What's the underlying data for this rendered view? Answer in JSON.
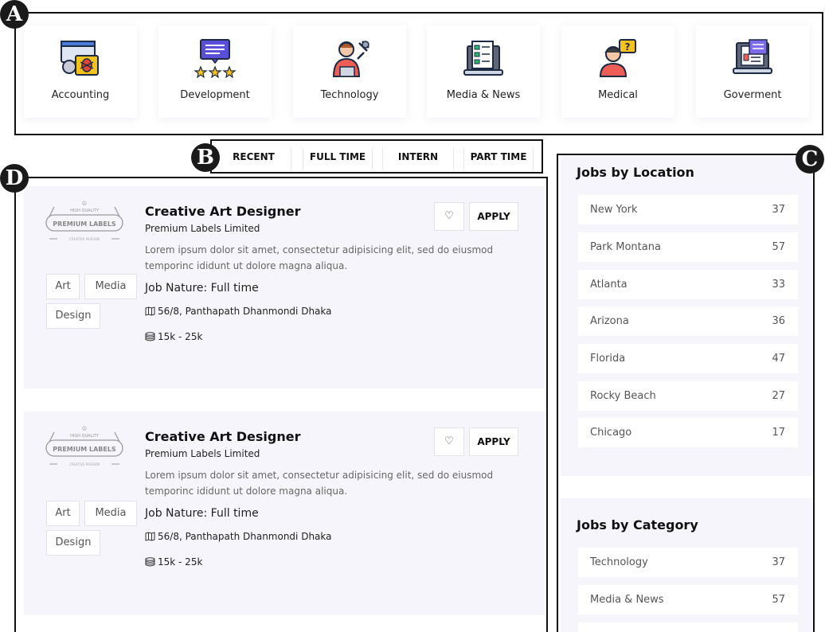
{
  "markers": [
    "A",
    "B",
    "C",
    "D"
  ],
  "categories": [
    {
      "label": "Accounting",
      "icon": "accounting-icon"
    },
    {
      "label": "Development",
      "icon": "development-icon"
    },
    {
      "label": "Technology",
      "icon": "technology-icon"
    },
    {
      "label": "Media & News",
      "icon": "media-news-icon"
    },
    {
      "label": "Medical",
      "icon": "medical-icon"
    },
    {
      "label": "Goverment",
      "icon": "government-icon"
    }
  ],
  "tabs": [
    "RECENT",
    "FULL TIME",
    "INTERN",
    "PART TIME"
  ],
  "jobs": [
    {
      "title": "Creative Art Designer",
      "company": "Premium Labels Limited",
      "description": "Lorem ipsum dolor sit amet, consectetur adipisicing elit, sed do eiusmod temporinc ididunt ut dolore magna aliqua.",
      "nature": "Job Nature: Full time",
      "address": "56/8, Panthapath Dhanmondi Dhaka",
      "salary": "15k - 25k",
      "tags": [
        "Art",
        "Media",
        "Design"
      ],
      "apply_label": "APPLY",
      "logo": {
        "top": "HIGH QUALITY",
        "main": "PREMIUM LABELS",
        "bottom": "CREATIVE PASSION"
      }
    },
    {
      "title": "Creative Art Designer",
      "company": "Premium Labels Limited",
      "description": "Lorem ipsum dolor sit amet, consectetur adipisicing elit, sed do eiusmod temporinc ididunt ut dolore magna aliqua.",
      "nature": "Job Nature: Full time",
      "address": "56/8, Panthapath Dhanmondi Dhaka",
      "salary": "15k - 25k",
      "tags": [
        "Art",
        "Media",
        "Design"
      ],
      "apply_label": "APPLY",
      "logo": {
        "top": "HIGH QUALITY",
        "main": "PREMIUM LABELS",
        "bottom": "CREATIVE PASSION"
      }
    }
  ],
  "sidebar": {
    "location_title": "Jobs by Location",
    "locations": [
      {
        "name": "New York",
        "count": "37"
      },
      {
        "name": "Park Montana",
        "count": "57"
      },
      {
        "name": "Atlanta",
        "count": "33"
      },
      {
        "name": "Arizona",
        "count": "36"
      },
      {
        "name": "Florida",
        "count": "47"
      },
      {
        "name": "Rocky Beach",
        "count": "27"
      },
      {
        "name": "Chicago",
        "count": "17"
      }
    ],
    "category_title": "Jobs by Category",
    "category_items": [
      {
        "name": "Technology",
        "count": "37"
      },
      {
        "name": "Media & News",
        "count": "57"
      }
    ]
  }
}
